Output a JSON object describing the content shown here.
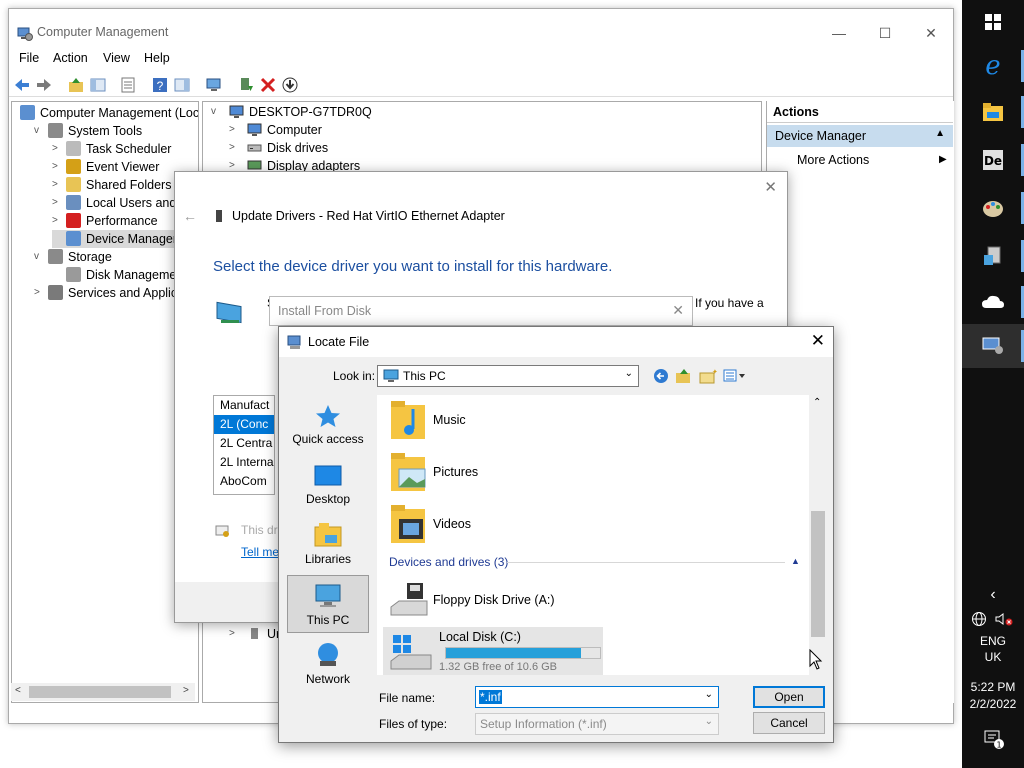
{
  "main_window": {
    "title": "Computer Management",
    "menu": [
      "File",
      "Action",
      "View",
      "Help"
    ]
  },
  "tree": {
    "items": [
      {
        "label": "Computer Management (Local",
        "level": 0,
        "exp": "",
        "icon": "computer-management-icon"
      },
      {
        "label": "System Tools",
        "level": 1,
        "exp": "v",
        "icon": "system-tools-icon"
      },
      {
        "label": "Task Scheduler",
        "level": 2,
        "exp": ">",
        "icon": "clock-icon"
      },
      {
        "label": "Event Viewer",
        "level": 2,
        "exp": ">",
        "icon": "event-viewer-icon"
      },
      {
        "label": "Shared Folders",
        "level": 2,
        "exp": ">",
        "icon": "shared-folder-icon"
      },
      {
        "label": "Local Users and Gro",
        "level": 2,
        "exp": ">",
        "icon": "users-icon"
      },
      {
        "label": "Performance",
        "level": 2,
        "exp": ">",
        "icon": "performance-icon"
      },
      {
        "label": "Device Manager",
        "level": 2,
        "exp": "",
        "icon": "device-manager-icon",
        "selected": true
      },
      {
        "label": "Storage",
        "level": 1,
        "exp": "v",
        "icon": "storage-icon"
      },
      {
        "label": "Disk Management",
        "level": 2,
        "exp": "",
        "icon": "disk-management-icon"
      },
      {
        "label": "Services and Applicatio",
        "level": 1,
        "exp": ">",
        "icon": "services-icon"
      }
    ]
  },
  "device_tree": {
    "root": "DESKTOP-G7TDR0Q",
    "items": [
      "Computer",
      "Disk drives",
      "Display adapters"
    ],
    "hidden_partial": "Ur"
  },
  "actions": {
    "header": "Actions",
    "selected": "Device Manager",
    "more": "More Actions"
  },
  "update_drivers": {
    "title": "Update Drivers - Red Hat VirtIO Ethernet Adapter",
    "heading": "Select the device driver you want to install for this hardware.",
    "desc_partial_left": "S",
    "desc_partial_right": "If you have a",
    "list_header": "Manufact",
    "list_items": [
      "2L (Conc",
      "2L Centra",
      "2L Interna",
      "AboCom"
    ],
    "signed_text": "This dr",
    "link_text": "Tell me"
  },
  "install_from_disk": {
    "title": "Install From Disk"
  },
  "locate_file": {
    "title": "Locate File",
    "look_in_label": "Look in:",
    "look_in_value": "This PC",
    "nav": [
      "Quick access",
      "Desktop",
      "Libraries",
      "This PC",
      "Network"
    ],
    "folders": [
      "Music",
      "Pictures",
      "Videos"
    ],
    "group_header": "Devices and drives (3)",
    "drives": [
      {
        "label": "Floppy Disk Drive (A:)"
      },
      {
        "label": "Local Disk (C:)",
        "free": "1.32 GB free of 10.6 GB",
        "used_fraction": 0.875
      }
    ],
    "file_name_label": "File name:",
    "file_name_value": "*.inf",
    "file_type_label": "Files of type:",
    "file_type_value": "Setup Information (*.inf)",
    "open_label": "Open",
    "cancel_label": "Cancel"
  },
  "taskbar": {
    "lang_top": "ENG",
    "lang_bottom": "UK",
    "time": "5:22 PM",
    "date": "2/2/2022",
    "notification_count": "1"
  }
}
